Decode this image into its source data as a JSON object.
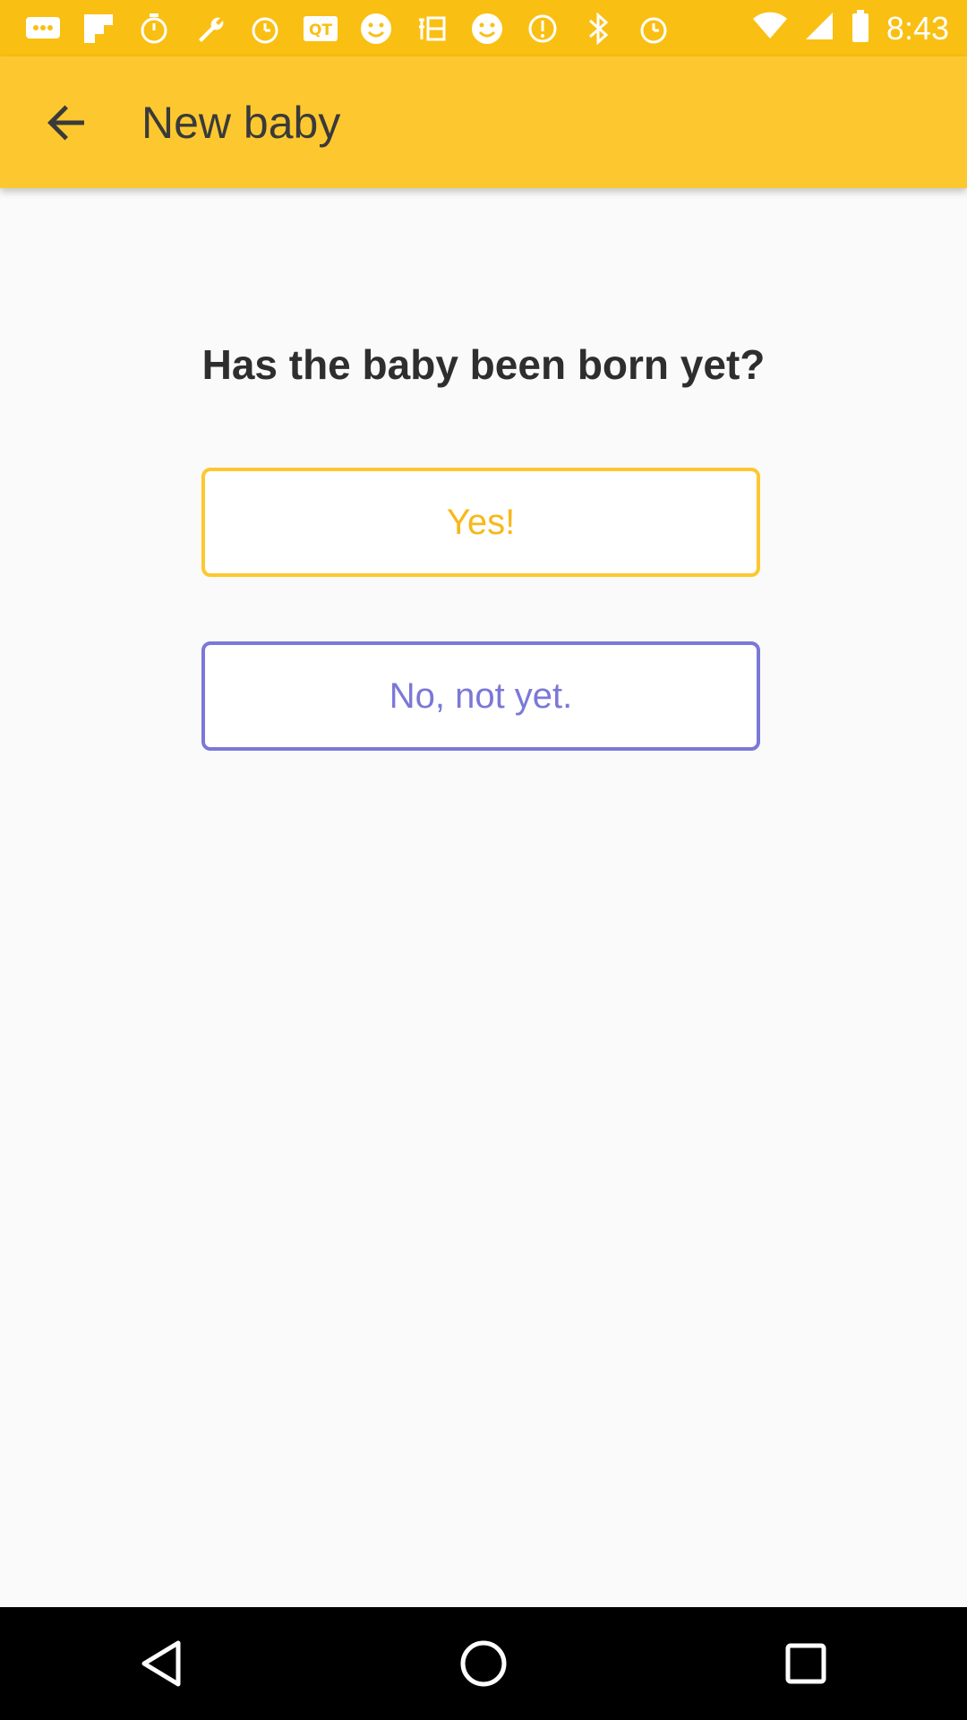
{
  "status_bar": {
    "time": "8:43",
    "left_icons": [
      "message-icon",
      "flipboard-icon",
      "timer-icon",
      "wrench-icon",
      "alarm-icon",
      "qt-icon",
      "smiley-icon",
      "taobao-icon",
      "smiley-icon",
      "alarm-icon",
      "bluetooth-icon",
      "alarm-icon"
    ],
    "color": "#f9bf13"
  },
  "app_bar": {
    "title": "New baby",
    "color": "#fdc82f"
  },
  "main": {
    "question": "Has the baby been born yet?",
    "yes_label": "Yes!",
    "no_label": "No, not yet.",
    "yes_color": "#fdc82f",
    "no_color": "#7b78d8"
  },
  "nav_bar": {
    "buttons": [
      "back-icon",
      "home-icon",
      "recents-icon"
    ]
  }
}
